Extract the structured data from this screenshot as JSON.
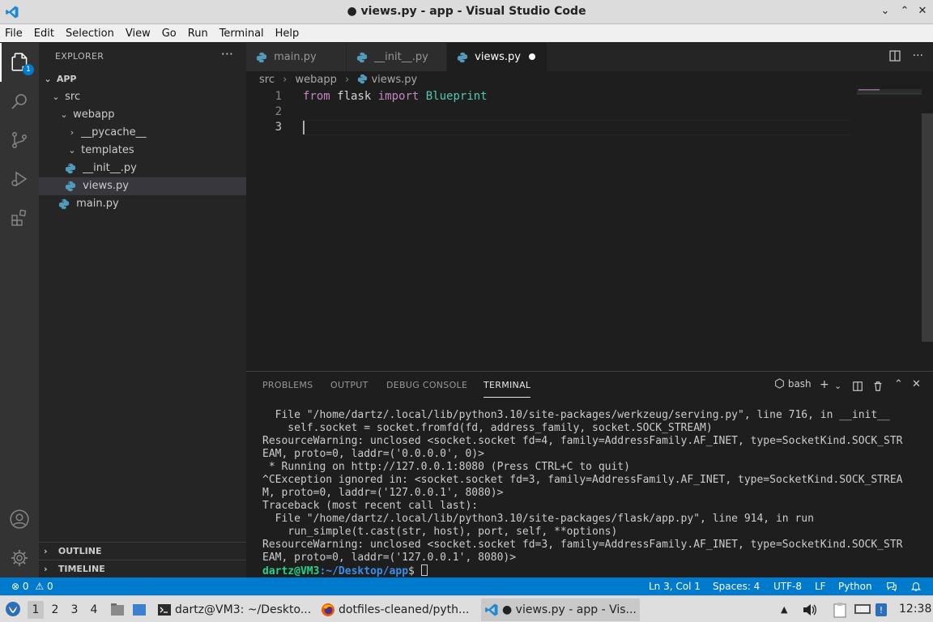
{
  "window": {
    "title": "● views.py - app - Visual Studio Code",
    "controls": {
      "minimize": "⌄",
      "maximize": "⌃",
      "close": "✕"
    }
  },
  "menu": [
    "File",
    "Edit",
    "Selection",
    "View",
    "Go",
    "Run",
    "Terminal",
    "Help"
  ],
  "activity": {
    "explorer_badge": "1",
    "icons": [
      "files-icon",
      "search-icon",
      "source-control-icon",
      "run-debug-icon",
      "extensions-icon",
      "account-icon",
      "settings-gear-icon"
    ]
  },
  "sidebar": {
    "title": "EXPLORER",
    "more": "···",
    "root": "APP",
    "tree": [
      {
        "label": "src",
        "kind": "folder-open"
      },
      {
        "label": "webapp",
        "kind": "folder-open"
      },
      {
        "label": "__pycache__",
        "kind": "folder-closed"
      },
      {
        "label": "templates",
        "kind": "folder-open"
      },
      {
        "label": "__init__.py",
        "kind": "python"
      },
      {
        "label": "views.py",
        "kind": "python",
        "selected": true
      },
      {
        "label": "main.py",
        "kind": "python"
      }
    ],
    "outline": "OUTLINE",
    "timeline": "TIMELINE"
  },
  "tabs": [
    {
      "label": "main.py"
    },
    {
      "label": "__init__.py"
    },
    {
      "label": "views.py",
      "active": true,
      "modified": true
    }
  ],
  "breadcrumb": [
    "src",
    "webapp",
    "views.py"
  ],
  "editor": {
    "line_numbers": [
      "1",
      "2",
      "3"
    ],
    "line1": {
      "kw1": "from",
      "mod": " flask ",
      "kw2": "import",
      "cls": " Blueprint"
    }
  },
  "panel": {
    "tabs": [
      "PROBLEMS",
      "OUTPUT",
      "DEBUG CONSOLE",
      "TERMINAL"
    ],
    "active_tab": "TERMINAL",
    "shell": "bash",
    "terminal_lines": [
      "  File \"/home/dartz/.local/lib/python3.10/site-packages/werkzeug/serving.py\", line 716, in __init__",
      "    self.socket = socket.fromfd(fd, address_family, socket.SOCK_STREAM)",
      "ResourceWarning: unclosed <socket.socket fd=4, family=AddressFamily.AF_INET, type=SocketKind.SOCK_STR",
      "EAM, proto=0, laddr=('0.0.0.0', 0)>",
      " * Running on http://127.0.0.1:8080 (Press CTRL+C to quit)",
      "^CException ignored in: <socket.socket fd=3, family=AddressFamily.AF_INET, type=SocketKind.SOCK_STREA",
      "M, proto=0, laddr=('127.0.0.1', 8080)>",
      "Traceback (most recent call last):",
      "  File \"/home/dartz/.local/lib/python3.10/site-packages/flask/app.py\", line 914, in run",
      "    run_simple(t.cast(str, host), port, self, **options)",
      "ResourceWarning: unclosed <socket.socket fd=3, family=AddressFamily.AF_INET, type=SocketKind.SOCK_STR",
      "EAM, proto=0, laddr=('127.0.0.1', 8080)>"
    ],
    "prompt_user": "dartz@VM3",
    "prompt_path": ":~/Desktop/app",
    "prompt_symbol": "$ "
  },
  "status": {
    "errors": "0",
    "warnings": "0",
    "position": "Ln 3, Col 1",
    "spaces": "Spaces: 4",
    "encoding": "UTF-8",
    "eol": "LF",
    "language": "Python"
  },
  "taskbar": {
    "workspaces": [
      "1",
      "2",
      "3",
      "4"
    ],
    "tasks": [
      {
        "label": "dartz@VM3: ~/Deskto..."
      },
      {
        "label": "dotfiles-cleaned/pyth..."
      },
      {
        "label": "● views.py - app - Vis...",
        "active": true
      }
    ],
    "clock": "12:38"
  },
  "colors": {
    "accent": "#007acc",
    "python_icon": "#519aba",
    "keyword": "#c586c0",
    "class": "#4ec9b0",
    "prompt_user": "#23d18b",
    "prompt_path": "#3b8eea"
  }
}
